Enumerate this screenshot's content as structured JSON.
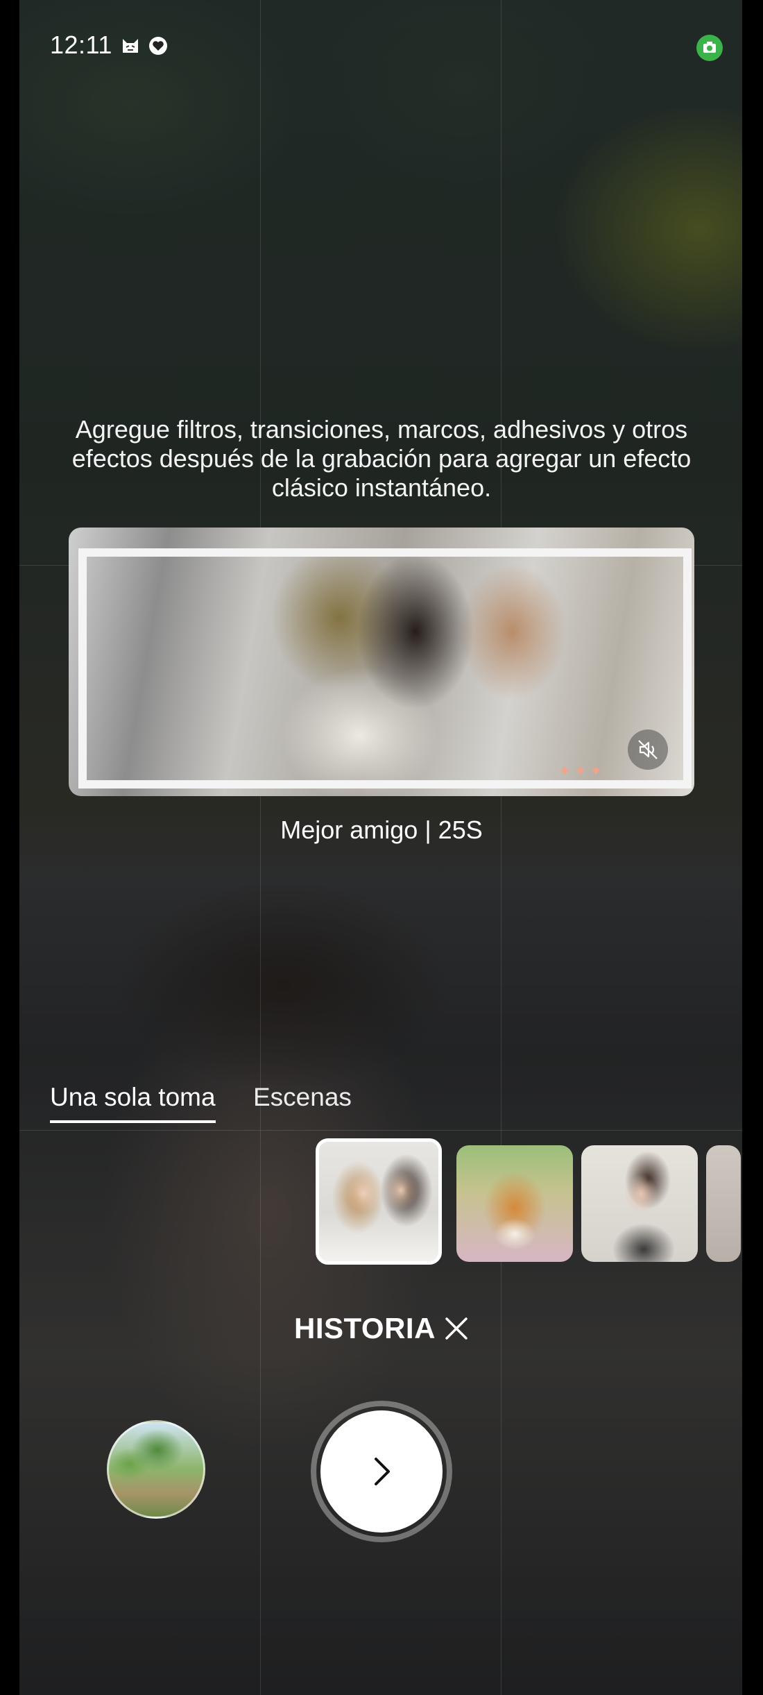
{
  "status_bar": {
    "time": "12:11",
    "icons": [
      "cat-notification-icon",
      "heart-shield-icon"
    ],
    "camera_indicator_color": "#3bb24a"
  },
  "template_preview": {
    "description": "Agregue filtros, transiciones, marcos, adhesivos y otros efectos después de la grabación para agregar un efecto clásico instantáneo.",
    "caption": "Mejor amigo | 25S",
    "mute_icon": "speaker-muted-icon",
    "stars": "✦✦✦"
  },
  "tabs": [
    {
      "label": "Una sola toma",
      "active": true
    },
    {
      "label": "Escenas",
      "active": false
    }
  ],
  "templates": [
    {
      "name": "two-women-template",
      "selected": true
    },
    {
      "name": "corgi-template",
      "selected": false
    },
    {
      "name": "woman-plant-template",
      "selected": false
    },
    {
      "name": "partial-template",
      "selected": false
    }
  ],
  "mode": {
    "label": "HISTORIA",
    "close_icon": "close-icon"
  },
  "controls": {
    "gallery": "gallery-thumbnail",
    "shutter_icon": "chevron-right-icon"
  }
}
